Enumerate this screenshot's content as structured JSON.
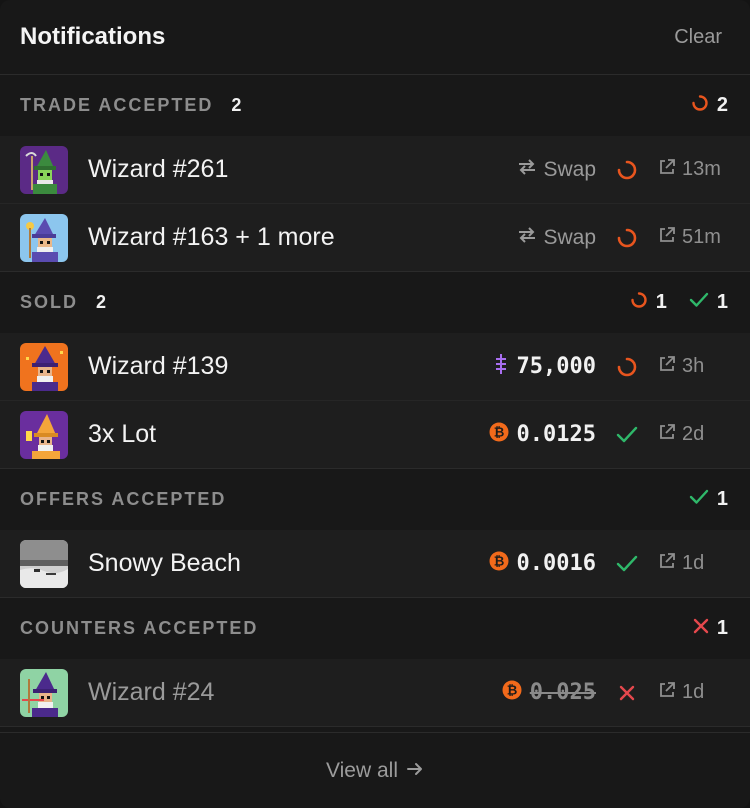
{
  "header": {
    "title": "Notifications",
    "clear_label": "Clear"
  },
  "colors": {
    "pending": "#e8551e",
    "success": "#2fb86a",
    "failed": "#e5484d",
    "bitcoin": "#f26a1b",
    "ether": "#a86ef0"
  },
  "sections": [
    {
      "title": "TRADE ACCEPTED",
      "count": "2",
      "stats": [
        {
          "icon": "pending-icon",
          "value": "2"
        }
      ],
      "items": [
        {
          "name": "Wizard #261",
          "type_label": "Swap",
          "status": "pending",
          "time": "13m",
          "thumb": "purple-wizard"
        },
        {
          "name": "Wizard #163 + 1 more",
          "type_label": "Swap",
          "status": "pending",
          "time": "51m",
          "thumb": "blue-wizard"
        }
      ]
    },
    {
      "title": "SOLD",
      "count": "2",
      "stats": [
        {
          "icon": "pending-icon",
          "value": "1"
        },
        {
          "icon": "check-icon",
          "value": "1"
        }
      ],
      "items": [
        {
          "name": "Wizard #139",
          "currency": "rune",
          "price": "75,000",
          "status": "pending",
          "time": "3h",
          "thumb": "orange-wizard"
        },
        {
          "name": "3x Lot",
          "currency": "bitcoin",
          "price": "0.0125",
          "status": "success",
          "time": "2d",
          "thumb": "violet-wizard"
        }
      ]
    },
    {
      "title": "OFFERS ACCEPTED",
      "count": "",
      "stats": [
        {
          "icon": "check-icon",
          "value": "1"
        }
      ],
      "items": [
        {
          "name": "Snowy Beach",
          "currency": "bitcoin",
          "price": "0.0016",
          "status": "success",
          "time": "1d",
          "thumb": "beach"
        }
      ]
    },
    {
      "title": "COUNTERS ACCEPTED",
      "count": "",
      "stats": [
        {
          "icon": "x-icon",
          "value": "1"
        }
      ],
      "items": [
        {
          "name": "Wizard #24",
          "currency": "bitcoin",
          "price": "0.025",
          "status": "failed",
          "time": "1d",
          "thumb": "green-wizard"
        }
      ]
    }
  ],
  "footer": {
    "view_all_label": "View all"
  }
}
